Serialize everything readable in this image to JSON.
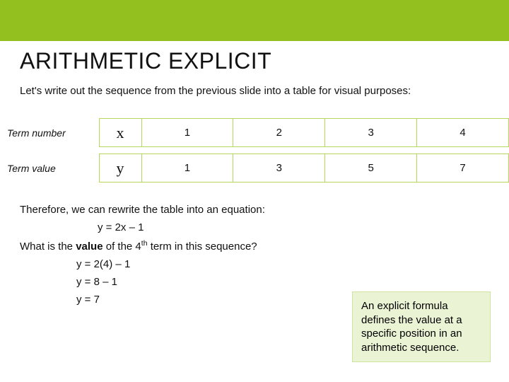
{
  "title": "ARITHMETIC EXPLICIT",
  "intro": "Let's write out the sequence from the previous slide into a table for visual purposes:",
  "table": {
    "row1_label": "Term number",
    "row1_var": "x",
    "row1_vals": [
      "1",
      "2",
      "3",
      "4"
    ],
    "row2_label": "Term value",
    "row2_var": "y",
    "row2_vals": [
      "1",
      "3",
      "5",
      "7"
    ]
  },
  "rewrite_text": "Therefore, we can rewrite the table into an equation:",
  "equation": "y = 2x – 1",
  "question_prefix": "What is the ",
  "question_bold": "value",
  "question_mid": " of the 4",
  "question_sup": "th",
  "question_suffix": " term in this sequence?",
  "work": [
    "y = 2(4) – 1",
    "y = 8 – 1",
    "y = 7"
  ],
  "callout": "An explicit formula defines the value at a specific position in an arithmetic sequence.",
  "chart_data": {
    "type": "table",
    "title": "Arithmetic sequence term table",
    "columns": [
      "Term number (x)",
      "Term value (y)"
    ],
    "rows": [
      [
        1,
        1
      ],
      [
        2,
        3
      ],
      [
        3,
        5
      ],
      [
        4,
        7
      ]
    ]
  }
}
